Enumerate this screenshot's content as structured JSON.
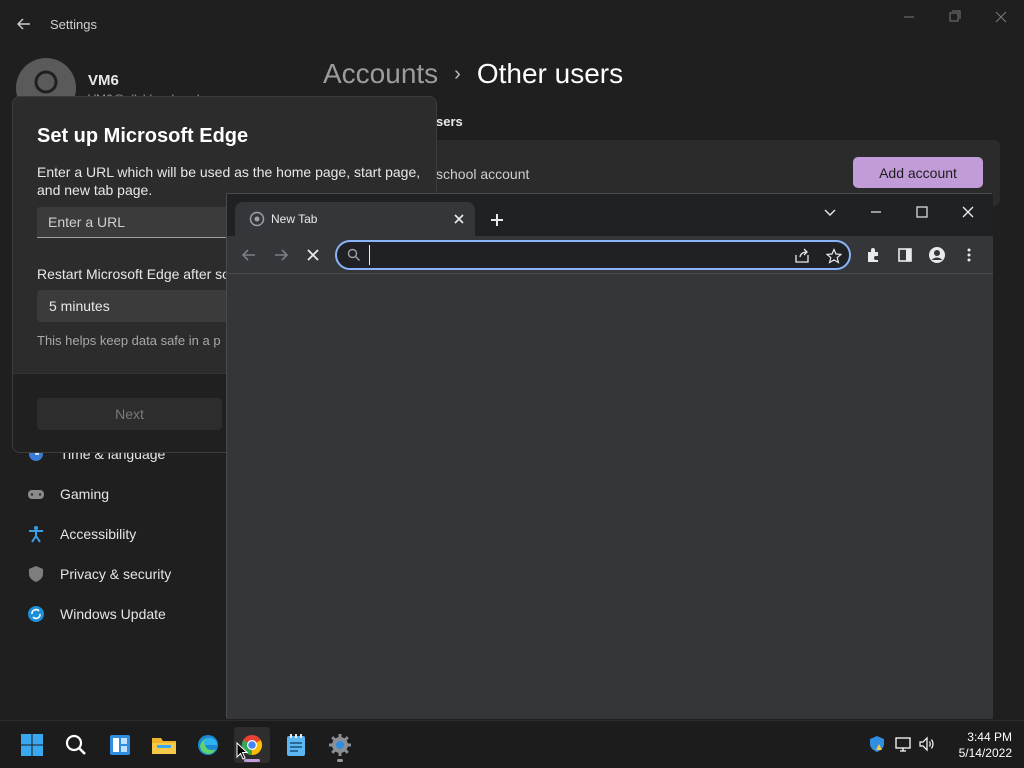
{
  "settings": {
    "app_title": "Settings",
    "profile": {
      "name": "VM6",
      "email": "VM6@allyblocal.ocal"
    },
    "breadcrumb": {
      "parent": "Accounts",
      "separator": "›",
      "current": "Other users"
    },
    "section_label": "sers",
    "account_text": "school account",
    "add_account_label": "Add account",
    "nav_items": [
      {
        "label": "Time & language",
        "icon": "globe-clock-icon"
      },
      {
        "label": "Gaming",
        "icon": "gamepad-icon"
      },
      {
        "label": "Accessibility",
        "icon": "accessibility-icon"
      },
      {
        "label": "Privacy & security",
        "icon": "shield-icon"
      },
      {
        "label": "Windows Update",
        "icon": "refresh-icon"
      }
    ],
    "accent_color": "#c29bd9"
  },
  "edge_setup": {
    "title": "Set up Microsoft Edge",
    "description": "Enter a URL which will be used as the home page, start page, and new tab page.",
    "url_placeholder": "Enter a URL",
    "restart_label": "Restart Microsoft Edge after so",
    "restart_value": "5 minutes",
    "note": "This helps keep data safe in a p",
    "next_label": "Next"
  },
  "chrome": {
    "tab_title": "New Tab",
    "omnibox_value": "",
    "focus_color": "#8ab4f8"
  },
  "taskbar": {
    "apps": [
      "start-icon",
      "search-icon",
      "widgets-icon",
      "file-explorer-icon",
      "edge-icon",
      "chrome-icon",
      "notepad-icon",
      "settings-icon"
    ],
    "clock": {
      "time": "3:44 PM",
      "date": "5/14/2022"
    }
  }
}
